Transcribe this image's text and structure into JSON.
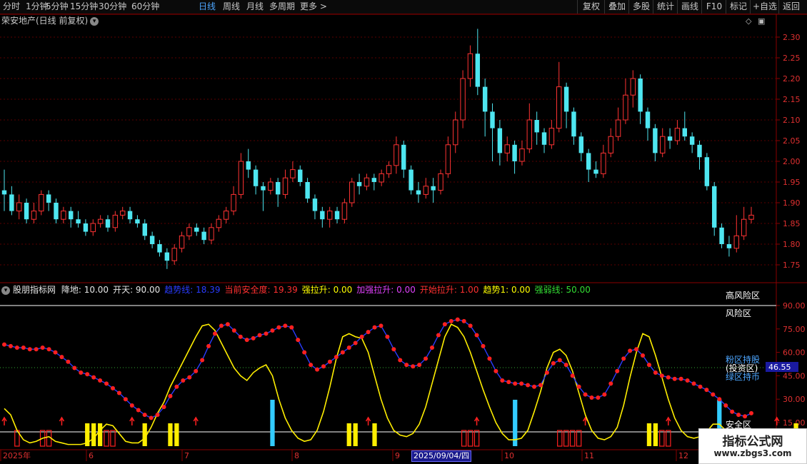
{
  "toolbar": {
    "periods": [
      "分时",
      "1分钟",
      "5分钟",
      "15分钟",
      "30分钟",
      "60分钟",
      "日线",
      "周线",
      "月线",
      "多周期",
      "更多 >"
    ],
    "active_period": "日线",
    "right_buttons": [
      "复权",
      "叠加",
      "多股",
      "统计",
      "画线",
      "F10",
      "标记",
      "+自选",
      "返回"
    ]
  },
  "stock": {
    "title": "荣安地产(日线 前复权)"
  },
  "price_axis": {
    "ticks": [
      "2.30",
      "2.25",
      "2.20",
      "2.15",
      "2.10",
      "2.05",
      "2.00",
      "1.95",
      "1.90",
      "1.85",
      "1.80",
      "1.75"
    ]
  },
  "indicator": {
    "name": "股朋指标网",
    "params": [
      {
        "text": "降地: 10.00",
        "color": "#e6e6e6"
      },
      {
        "text": "开天: 90.00",
        "color": "#e6e6e6"
      },
      {
        "text": "趋势线: 18.39",
        "color": "#2a3cff"
      },
      {
        "text": "当前安全度: 19.39",
        "color": "#ff3030"
      },
      {
        "text": "强拉升: 0.00",
        "color": "#ffff00"
      },
      {
        "text": "加强拉升: 0.00",
        "color": "#e040fb"
      },
      {
        "text": "开始拉升: 1.00",
        "color": "#ff3030"
      },
      {
        "text": "趋势1: 0.00",
        "color": "#ffff00"
      },
      {
        "text": "强弱线: 50.00",
        "color": "#33dd33"
      }
    ],
    "axis_ticks": [
      "90.00",
      "75.00",
      "60.00",
      "45.00",
      "30.00",
      "15.00"
    ],
    "current_value": "46.55",
    "zone_labels": {
      "risk_top": "高风险区",
      "risk": "风险区",
      "pink_hold": "粉区持股",
      "invest": "(投资区)",
      "green_hold": "绿区持币",
      "safe": "安全区"
    }
  },
  "date_axis": {
    "labels": [
      "2025年",
      "6",
      "7",
      "8",
      "9",
      "10",
      "11",
      "12"
    ],
    "highlight": "2025/09/04/四"
  },
  "watermark": {
    "title": "指标公式网",
    "url": "www.zbgs3.com"
  },
  "chart_data": {
    "type": "candlestick",
    "title": "荣安地产(日线 前复权)",
    "ylim": [
      1.72,
      2.34
    ],
    "up_color": "#ff3333",
    "down_color": "#4ee6f0",
    "candles": [
      [
        1.93,
        1.92,
        1.98,
        1.88
      ],
      [
        1.92,
        1.88,
        1.94,
        1.87
      ],
      [
        1.88,
        1.9,
        1.92,
        1.86
      ],
      [
        1.9,
        1.86,
        1.91,
        1.85
      ],
      [
        1.86,
        1.88,
        1.9,
        1.85
      ],
      [
        1.88,
        1.92,
        1.93,
        1.87
      ],
      [
        1.92,
        1.9,
        1.93,
        1.88
      ],
      [
        1.9,
        1.86,
        1.91,
        1.85
      ],
      [
        1.86,
        1.88,
        1.89,
        1.85
      ],
      [
        1.88,
        1.86,
        1.89,
        1.84
      ],
      [
        1.86,
        1.85,
        1.88,
        1.84
      ],
      [
        1.85,
        1.83,
        1.86,
        1.82
      ],
      [
        1.83,
        1.85,
        1.86,
        1.82
      ],
      [
        1.85,
        1.86,
        1.87,
        1.84
      ],
      [
        1.86,
        1.84,
        1.87,
        1.83
      ],
      [
        1.84,
        1.87,
        1.88,
        1.83
      ],
      [
        1.87,
        1.88,
        1.89,
        1.86
      ],
      [
        1.88,
        1.86,
        1.89,
        1.85
      ],
      [
        1.86,
        1.85,
        1.87,
        1.84
      ],
      [
        1.85,
        1.82,
        1.86,
        1.81
      ],
      [
        1.82,
        1.8,
        1.83,
        1.79
      ],
      [
        1.8,
        1.78,
        1.81,
        1.77
      ],
      [
        1.78,
        1.76,
        1.79,
        1.74
      ],
      [
        1.76,
        1.79,
        1.8,
        1.75
      ],
      [
        1.79,
        1.82,
        1.83,
        1.78
      ],
      [
        1.82,
        1.84,
        1.85,
        1.81
      ],
      [
        1.84,
        1.83,
        1.85,
        1.82
      ],
      [
        1.83,
        1.81,
        1.84,
        1.8
      ],
      [
        1.81,
        1.84,
        1.85,
        1.8
      ],
      [
        1.84,
        1.86,
        1.87,
        1.83
      ],
      [
        1.86,
        1.88,
        1.89,
        1.85
      ],
      [
        1.88,
        1.92,
        1.94,
        1.87
      ],
      [
        1.92,
        2.0,
        2.02,
        1.91
      ],
      [
        2.0,
        1.98,
        2.03,
        1.96
      ],
      [
        1.98,
        1.94,
        1.99,
        1.92
      ],
      [
        1.94,
        1.93,
        1.95,
        1.88
      ],
      [
        1.93,
        1.95,
        1.96,
        1.92
      ],
      [
        1.95,
        1.92,
        1.96,
        1.89
      ],
      [
        1.92,
        1.96,
        1.98,
        1.91
      ],
      [
        1.96,
        1.98,
        2.0,
        1.95
      ],
      [
        1.98,
        1.95,
        1.99,
        1.94
      ],
      [
        1.95,
        1.91,
        1.96,
        1.9
      ],
      [
        1.91,
        1.88,
        1.92,
        1.86
      ],
      [
        1.88,
        1.86,
        1.89,
        1.84
      ],
      [
        1.86,
        1.88,
        1.89,
        1.84
      ],
      [
        1.88,
        1.86,
        1.89,
        1.85
      ],
      [
        1.86,
        1.9,
        1.91,
        1.85
      ],
      [
        1.9,
        1.95,
        1.96,
        1.89
      ],
      [
        1.95,
        1.94,
        1.97,
        1.92
      ],
      [
        1.94,
        1.96,
        1.97,
        1.93
      ],
      [
        1.96,
        1.95,
        1.97,
        1.93
      ],
      [
        1.95,
        1.97,
        1.98,
        1.94
      ],
      [
        1.97,
        1.99,
        2.0,
        1.96
      ],
      [
        1.99,
        2.04,
        2.06,
        1.97
      ],
      [
        2.04,
        1.98,
        2.05,
        1.96
      ],
      [
        1.98,
        1.93,
        1.99,
        1.92
      ],
      [
        1.93,
        1.92,
        1.95,
        1.9
      ],
      [
        1.92,
        1.94,
        1.96,
        1.91
      ],
      [
        1.94,
        1.93,
        1.96,
        1.9
      ],
      [
        1.93,
        1.97,
        1.98,
        1.92
      ],
      [
        1.97,
        2.04,
        2.06,
        1.96
      ],
      [
        2.04,
        2.1,
        2.12,
        2.02
      ],
      [
        2.1,
        2.2,
        2.22,
        2.08
      ],
      [
        2.2,
        2.26,
        2.28,
        2.18
      ],
      [
        2.26,
        2.18,
        2.32,
        2.16
      ],
      [
        2.18,
        2.12,
        2.2,
        2.06
      ],
      [
        2.12,
        2.08,
        2.14,
        2.0
      ],
      [
        2.08,
        2.02,
        2.1,
        1.99
      ],
      [
        2.02,
        2.04,
        2.06,
        2.0
      ],
      [
        2.04,
        2.0,
        2.05,
        1.97
      ],
      [
        2.0,
        2.03,
        2.05,
        1.99
      ],
      [
        2.03,
        2.1,
        2.14,
        2.02
      ],
      [
        2.1,
        2.07,
        2.12,
        2.04
      ],
      [
        2.07,
        2.04,
        2.08,
        2.02
      ],
      [
        2.04,
        2.08,
        2.1,
        2.03
      ],
      [
        2.08,
        2.18,
        2.24,
        2.07
      ],
      [
        2.18,
        2.12,
        2.19,
        2.08
      ],
      [
        2.12,
        2.06,
        2.13,
        2.04
      ],
      [
        2.06,
        2.02,
        2.07,
        2.0
      ],
      [
        2.02,
        1.98,
        2.03,
        1.95
      ],
      [
        1.98,
        1.97,
        2.0,
        1.96
      ],
      [
        1.97,
        2.02,
        2.04,
        1.96
      ],
      [
        2.02,
        2.06,
        2.08,
        2.01
      ],
      [
        2.06,
        2.1,
        2.13,
        2.05
      ],
      [
        2.1,
        2.16,
        2.2,
        2.09
      ],
      [
        2.16,
        2.2,
        2.22,
        2.13
      ],
      [
        2.2,
        2.12,
        2.21,
        2.09
      ],
      [
        2.12,
        2.08,
        2.13,
        2.05
      ],
      [
        2.08,
        2.02,
        2.09,
        2.0
      ],
      [
        2.02,
        2.06,
        2.08,
        2.01
      ],
      [
        2.06,
        2.05,
        2.08,
        2.03
      ],
      [
        2.05,
        2.08,
        2.1,
        2.04
      ],
      [
        2.08,
        2.06,
        2.12,
        2.05
      ],
      [
        2.06,
        2.04,
        2.07,
        2.02
      ],
      [
        2.04,
        2.01,
        2.05,
        1.98
      ],
      [
        2.01,
        1.94,
        2.02,
        1.93
      ],
      [
        1.94,
        1.84,
        1.95,
        1.82
      ],
      [
        1.84,
        1.8,
        1.85,
        1.79
      ],
      [
        1.8,
        1.79,
        1.82,
        1.77
      ],
      [
        1.79,
        1.82,
        1.87,
        1.78
      ],
      [
        1.82,
        1.86,
        1.89,
        1.81
      ],
      [
        1.86,
        1.87,
        1.89,
        1.85
      ]
    ],
    "indicator": {
      "red_line": [
        65,
        64,
        63,
        63,
        62,
        62,
        63,
        62,
        60,
        57,
        54,
        50,
        47,
        46,
        44,
        42,
        40,
        37,
        34,
        30,
        26,
        23,
        20,
        18,
        20,
        25,
        32,
        38,
        42,
        44,
        48,
        55,
        64,
        72,
        77,
        78,
        74,
        70,
        68,
        69,
        71,
        72,
        74,
        76,
        77,
        76,
        68,
        60,
        52,
        49,
        51,
        54,
        57,
        60,
        63,
        66,
        70,
        73,
        76,
        77,
        70,
        62,
        55,
        52,
        51,
        52,
        56,
        63,
        71,
        78,
        80,
        81,
        80,
        77,
        71,
        64,
        56,
        48,
        42,
        41,
        40,
        40,
        39,
        38,
        39,
        47,
        53,
        55,
        52,
        45,
        38,
        33,
        31,
        31,
        33,
        40,
        48,
        56,
        61,
        62,
        58,
        52,
        47,
        45,
        44,
        43,
        43,
        42,
        40,
        38,
        36,
        33,
        30,
        26,
        22,
        20,
        19,
        21
      ],
      "yellow_line": [
        24,
        20,
        10,
        4,
        2,
        3,
        5,
        6,
        3,
        2,
        1,
        1,
        1,
        2,
        5,
        10,
        14,
        13,
        8,
        3,
        2,
        2,
        5,
        12,
        21,
        28,
        38,
        46,
        54,
        62,
        70,
        77,
        78,
        74,
        66,
        58,
        50,
        45,
        42,
        47,
        50,
        52,
        45,
        30,
        18,
        10,
        5,
        3,
        4,
        10,
        22,
        38,
        56,
        70,
        72,
        70,
        69,
        60,
        45,
        30,
        18,
        10,
        7,
        6,
        8,
        14,
        25,
        40,
        55,
        70,
        78,
        76,
        70,
        60,
        48,
        36,
        25,
        15,
        8,
        4,
        4,
        5,
        10,
        22,
        35,
        50,
        60,
        62,
        58,
        48,
        34,
        20,
        10,
        5,
        4,
        6,
        12,
        26,
        44,
        60,
        72,
        70,
        58,
        44,
        30,
        18,
        10,
        6,
        5,
        6,
        9,
        14,
        14,
        10,
        6,
        4,
        3,
        3
      ],
      "bars": [
        {
          "i": 2,
          "c": "r"
        },
        {
          "i": 6,
          "c": "r"
        },
        {
          "i": 7,
          "c": "r"
        },
        {
          "i": 13,
          "c": "y"
        },
        {
          "i": 14,
          "c": "y"
        },
        {
          "i": 15,
          "c": "y"
        },
        {
          "i": 16,
          "c": "r"
        },
        {
          "i": 17,
          "c": "r"
        },
        {
          "i": 22,
          "c": "y"
        },
        {
          "i": 26,
          "c": "y"
        },
        {
          "i": 27,
          "c": "y"
        },
        {
          "i": 42,
          "c": "c"
        },
        {
          "i": 54,
          "c": "y"
        },
        {
          "i": 55,
          "c": "y"
        },
        {
          "i": 58,
          "c": "y"
        },
        {
          "i": 72,
          "c": "r"
        },
        {
          "i": 73,
          "c": "r"
        },
        {
          "i": 74,
          "c": "r"
        },
        {
          "i": 80,
          "c": "c"
        },
        {
          "i": 87,
          "c": "r"
        },
        {
          "i": 88,
          "c": "r"
        },
        {
          "i": 89,
          "c": "r"
        },
        {
          "i": 90,
          "c": "r"
        },
        {
          "i": 101,
          "c": "y"
        },
        {
          "i": 102,
          "c": "y"
        },
        {
          "i": 103,
          "c": "r"
        },
        {
          "i": 104,
          "c": "r"
        },
        {
          "i": 112,
          "c": "c"
        },
        {
          "i": 118,
          "c": "r"
        },
        {
          "i": 119,
          "c": "r"
        },
        {
          "i": 120,
          "c": "r"
        },
        {
          "i": 121,
          "c": "r"
        },
        {
          "i": 124,
          "c": "y"
        }
      ],
      "arrows": [
        0,
        9,
        20,
        30,
        57,
        74,
        91,
        104,
        121
      ]
    }
  }
}
